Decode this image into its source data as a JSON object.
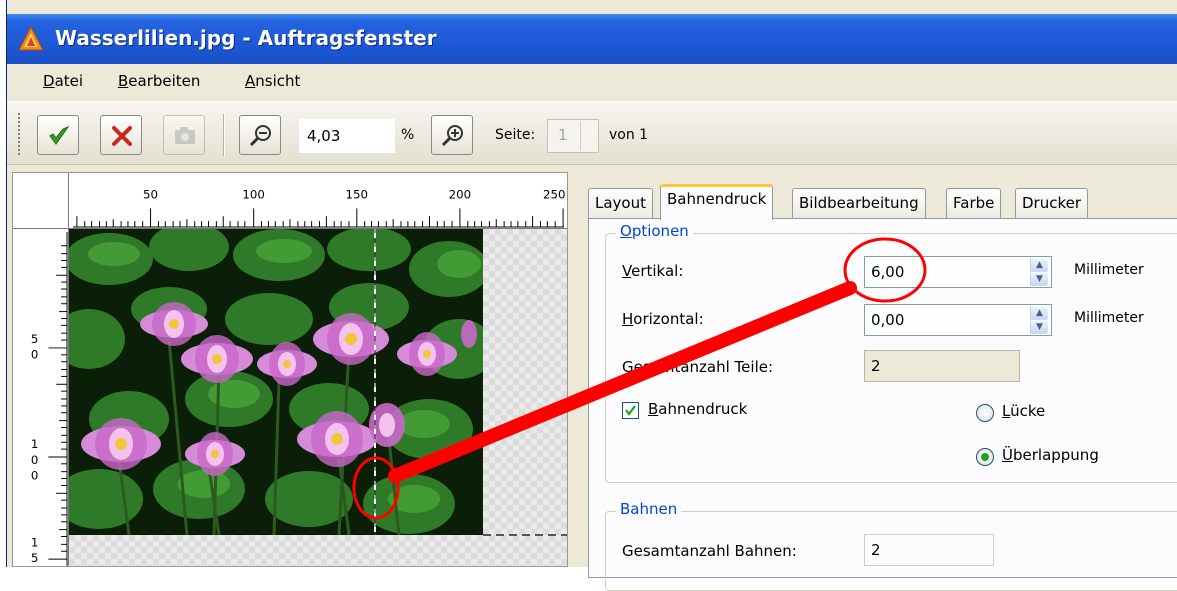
{
  "window": {
    "title": "Wasserlilien.jpg - Auftragsfenster"
  },
  "menu": {
    "items": [
      "Datei",
      "Bearbeiten",
      "Ansicht"
    ]
  },
  "toolbar": {
    "zoom_value": "4,03",
    "zoom_unit": "%",
    "page_label": "Seite:",
    "page_value": "1",
    "page_of": "von 1"
  },
  "rulers": {
    "top_ticks": [
      "50",
      "100",
      "150",
      "200",
      "250"
    ],
    "left_ticks": [
      [
        "5",
        "0"
      ],
      [
        "1",
        "0",
        "0"
      ],
      [
        "1",
        "5"
      ]
    ]
  },
  "tabs": [
    "Layout",
    "Bahnendruck",
    "Bildbearbeitung",
    "Farbe",
    "Drucker"
  ],
  "active_tab": "Bahnendruck",
  "options": {
    "legend": "Optionen",
    "vertical_label": "Vertikal:",
    "vertical_value": "6,00",
    "vertical_unit": "Millimeter",
    "horizontal_label": "Horizontal:",
    "horizontal_value": "0,00",
    "horizontal_unit": "Millimeter",
    "total_parts_label": "Gesamtanzahl Teile:",
    "total_parts_value": "2",
    "tile_print_label": "Bahnendruck",
    "tile_print_checked": true,
    "gap_label": "Lücke",
    "overlap_label": "Überlappung",
    "selected_mode": "Überlappung"
  },
  "strips": {
    "legend": "Bahnen",
    "total_strips_label": "Gesamtanzahl Bahnen:",
    "total_strips_value": "2"
  },
  "colors": {
    "title_bar": "#1e58d6",
    "annotation": "#ff0000",
    "tab_highlight": "#ffc83c",
    "group_legend": "#0046d5"
  }
}
